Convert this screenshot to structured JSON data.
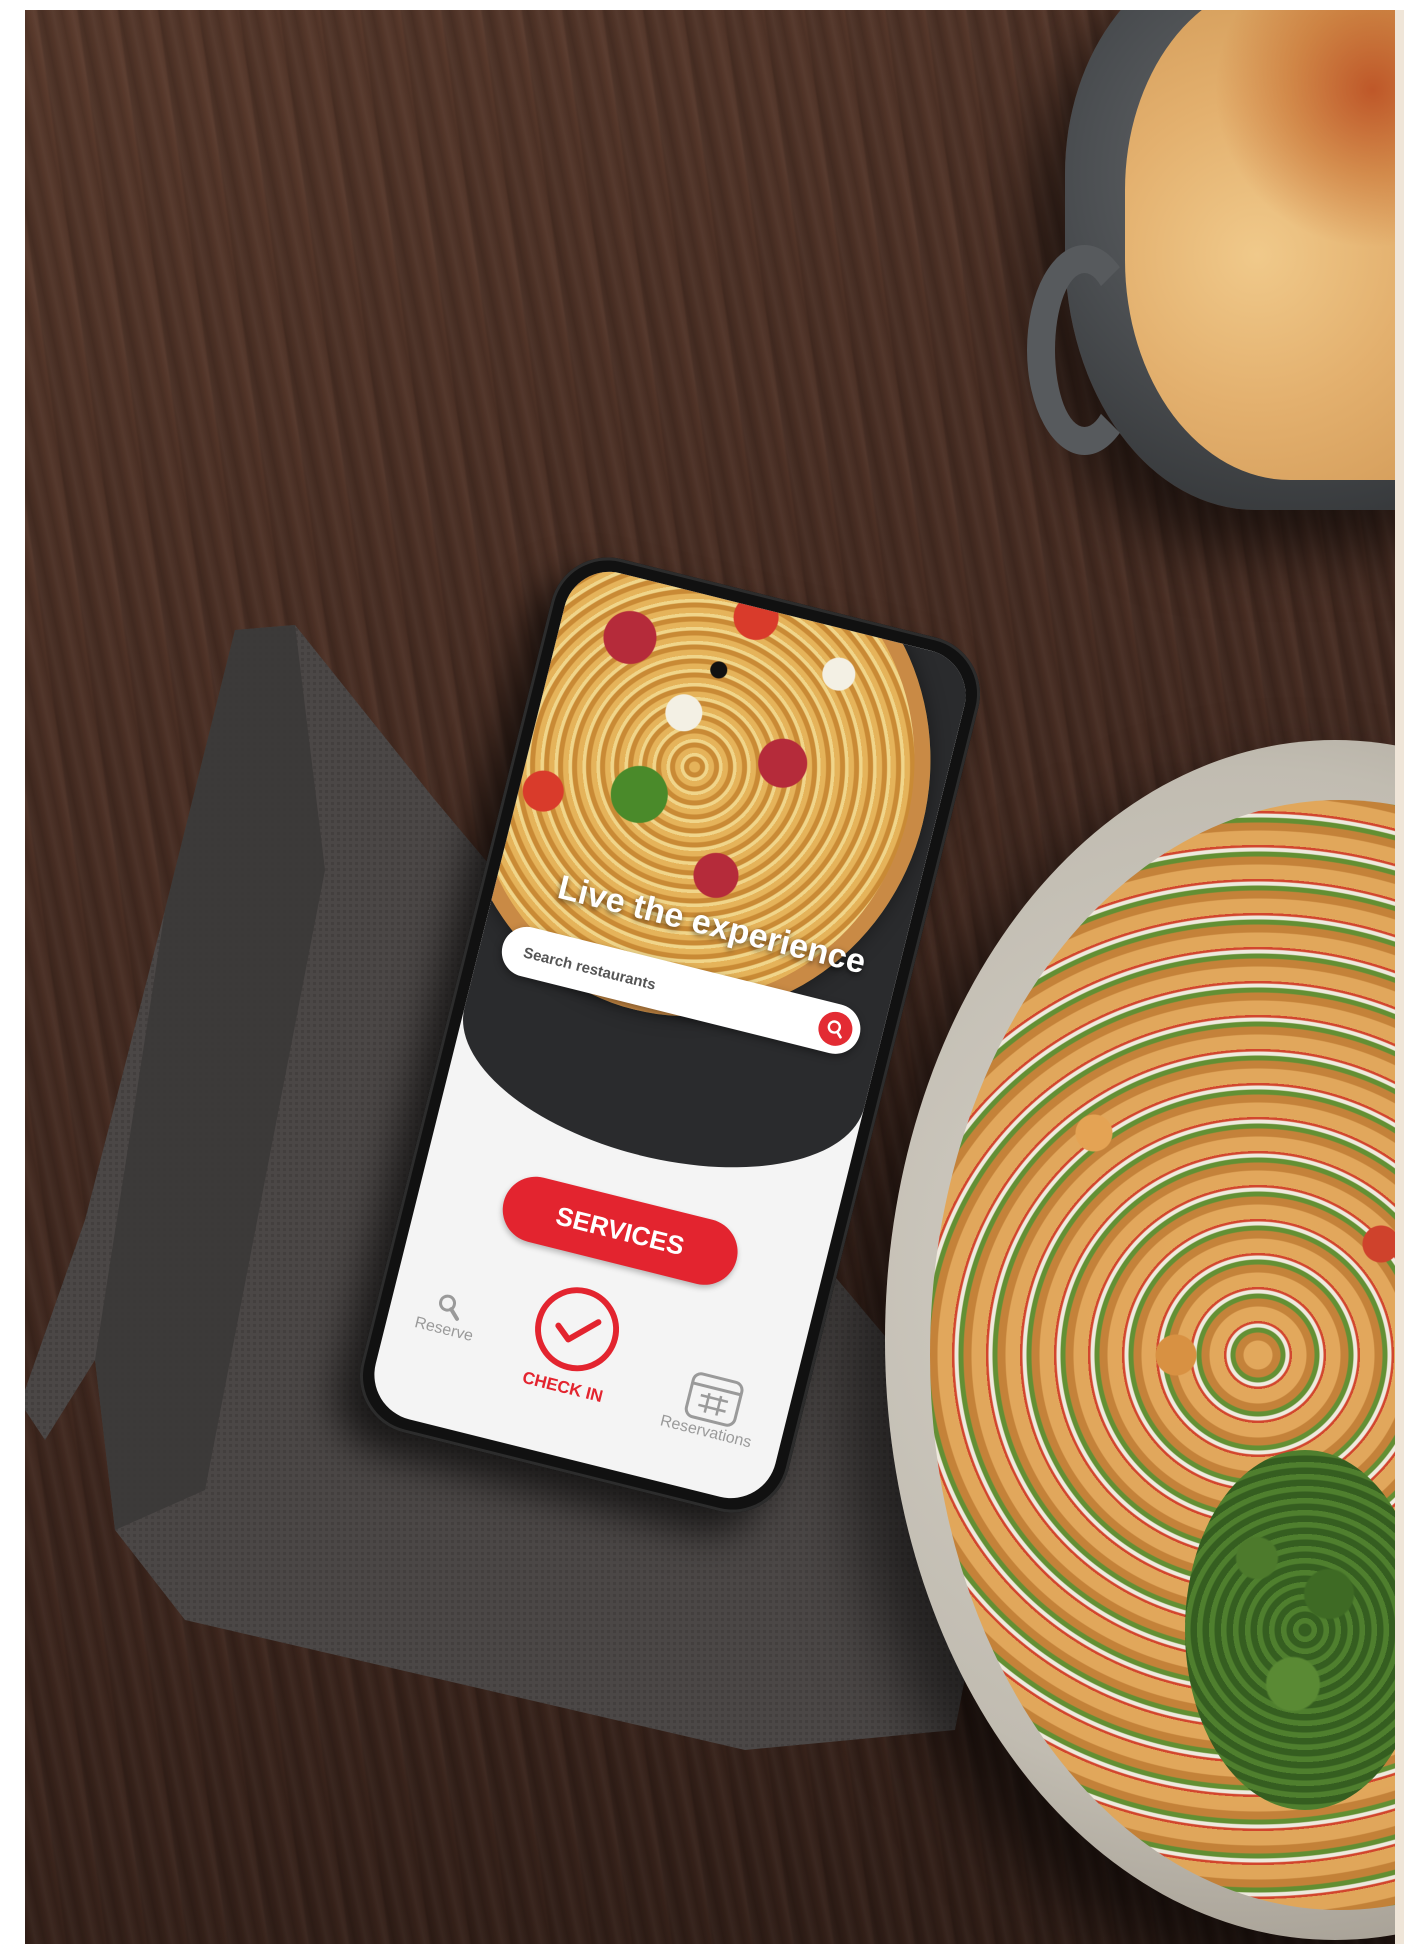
{
  "app": {
    "hero_title": "Live the experience",
    "search": {
      "placeholder": "Search restaurants",
      "button_icon": "search-icon"
    },
    "services_label": "SERVICES",
    "nav": {
      "reserve": {
        "label": "Reserve",
        "icon": "search-icon"
      },
      "check_in": {
        "label": "CHECK IN",
        "icon": "checkmark-circle-icon"
      },
      "reservations": {
        "label": "Reservations",
        "icon": "calendar-icon"
      }
    }
  },
  "colors": {
    "accent": "#e3242f",
    "inactive": "#9a9a9a",
    "screen_bg": "#f4f4f4"
  }
}
